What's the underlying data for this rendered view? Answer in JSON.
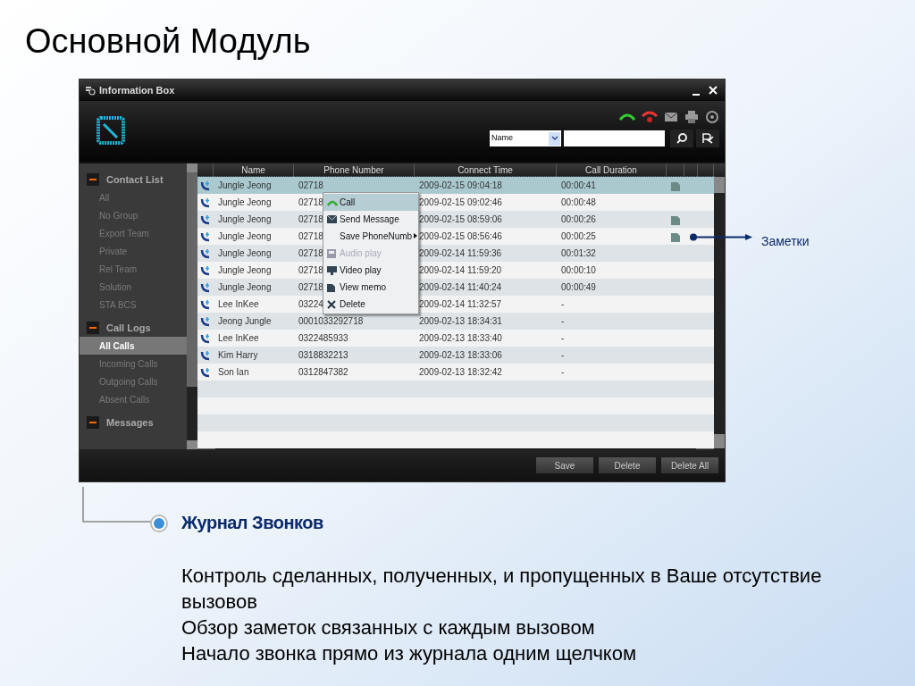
{
  "slide_title": "Основной Модуль",
  "window": {
    "title": "Information Box"
  },
  "search": {
    "filter": "Name"
  },
  "sidebar": [
    {
      "label": "Contact List",
      "expanded": true,
      "items": [
        {
          "label": "All",
          "selected": false
        },
        {
          "label": "No Group",
          "selected": false
        },
        {
          "label": "Export Team",
          "selected": false
        },
        {
          "label": "Private",
          "selected": false
        },
        {
          "label": "Rel Team",
          "selected": false
        },
        {
          "label": "Solution",
          "selected": false
        },
        {
          "label": "STA BCS",
          "selected": false
        }
      ]
    },
    {
      "label": "Call Logs",
      "expanded": true,
      "items": [
        {
          "label": "All Calls",
          "selected": true
        },
        {
          "label": "Incoming Calls",
          "selected": false
        },
        {
          "label": "Outgoing Calls",
          "selected": false
        },
        {
          "label": "Absent Calls",
          "selected": false
        }
      ]
    },
    {
      "label": "Messages",
      "expanded": true
    }
  ],
  "table": {
    "columns": [
      "Name",
      "Phone Number",
      "Connect Time",
      "Call Duration"
    ],
    "rows": [
      {
        "name": "Jungle Jeong",
        "phone": "02718",
        "time": "2009-02-15 09:04:18",
        "duration": "00:00:41",
        "memo": true,
        "selected": true
      },
      {
        "name": "Jungle Jeong",
        "phone": "02718",
        "time": "2009-02-15 09:02:46",
        "duration": "00:00:48",
        "memo": false,
        "selected": false
      },
      {
        "name": "Jungle Jeong",
        "phone": "02718",
        "time": "2009-02-15 08:59:06",
        "duration": "00:00:26",
        "memo": true,
        "selected": false
      },
      {
        "name": "Jungle Jeong",
        "phone": "02718",
        "time": "2009-02-15 08:56:46",
        "duration": "00:00:25",
        "memo": true,
        "selected": false
      },
      {
        "name": "Jungle Jeong",
        "phone": "02718",
        "time": "2009-02-14 11:59:36",
        "duration": "00:01:32",
        "memo": false,
        "selected": false
      },
      {
        "name": "Jungle Jeong",
        "phone": "02718",
        "time": "2009-02-14 11:59:20",
        "duration": "00:00:10",
        "memo": false,
        "selected": false
      },
      {
        "name": "Jungle Jeong",
        "phone": "02718",
        "time": "2009-02-14 11:40:24",
        "duration": "00:00:49",
        "memo": false,
        "selected": false
      },
      {
        "name": "Lee InKee",
        "phone": "03224",
        "time": "2009-02-14 11:32:57",
        "duration": "-",
        "memo": false,
        "selected": false
      },
      {
        "name": "Jeong Jungle",
        "phone": "0001033292718",
        "time": "2009-02-13 18:34:31",
        "duration": "-",
        "memo": false,
        "selected": false
      },
      {
        "name": "Lee InKee",
        "phone": "0322485933",
        "time": "2009-02-13 18:33:40",
        "duration": "-",
        "memo": false,
        "selected": false
      },
      {
        "name": "Kim Harry",
        "phone": "0318832213",
        "time": "2009-02-13 18:33:06",
        "duration": "-",
        "memo": false,
        "selected": false
      },
      {
        "name": "Son Ian",
        "phone": "0312847382",
        "time": "2009-02-13 18:32:42",
        "duration": "-",
        "memo": false,
        "selected": false
      }
    ]
  },
  "context_menu": [
    {
      "label": "Call",
      "kind": "call",
      "selected": true,
      "disabled": false,
      "submenu": false
    },
    {
      "label": "Send Message",
      "kind": "message",
      "selected": false,
      "disabled": false,
      "submenu": false
    },
    {
      "label": "Save PhoneNumb",
      "kind": "none",
      "selected": false,
      "disabled": false,
      "submenu": true
    },
    {
      "label": "Audio play",
      "kind": "audio",
      "selected": false,
      "disabled": true,
      "submenu": false
    },
    {
      "label": "Video play",
      "kind": "video",
      "selected": false,
      "disabled": false,
      "submenu": false
    },
    {
      "label": "View memo",
      "kind": "memo",
      "selected": false,
      "disabled": false,
      "submenu": false
    },
    {
      "label": "Delete",
      "kind": "delete",
      "selected": false,
      "disabled": false,
      "submenu": false
    }
  ],
  "buttons": [
    "Save",
    "Delete",
    "Delete All"
  ],
  "memo_callout": "Заметки",
  "section_heading": "Журнал Звонков",
  "description": [
    "Контроль сделанных, полученных, и пропущенных в Ваше отсутствие вызовов",
    "Обзор заметок связанных с каждым вызовом",
    "Начало звонка прямо из журнала одним щелчком"
  ]
}
